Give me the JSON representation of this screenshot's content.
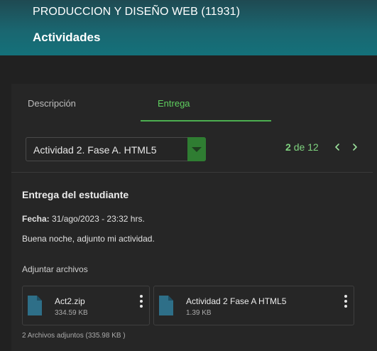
{
  "header": {
    "course_title": "PRODUCCION Y DISEÑO WEB (11931)",
    "page_title": "Actividades"
  },
  "tabs": [
    {
      "label": "Descripción",
      "active": false
    },
    {
      "label": "Entrega",
      "active": true
    }
  ],
  "activity_select": {
    "selected": "Actividad 2. Fase A. HTML5"
  },
  "pager": {
    "current": "2",
    "of_text": "de 12"
  },
  "submission": {
    "title": "Entrega del estudiante",
    "date_label": "Fecha:",
    "date_value": " 31/ago/2023 - 23:32 hrs.",
    "message": "Buena noche, adjunto mi actividad.",
    "attach_label": "Adjuntar archivos",
    "files": [
      {
        "name": "Act2.zip",
        "size": "334.59 KB",
        "icon": "file-icon"
      },
      {
        "name": "Actividad 2 Fase A HTML5",
        "size": "1.39 KB",
        "icon": "file-icon"
      }
    ],
    "summary": "2 Archivos adjuntos (335.98 KB )"
  },
  "colors": {
    "accent": "#4caf50",
    "header_teal": "#14717a",
    "background": "#212121",
    "file_icon": "#2e6f88"
  }
}
